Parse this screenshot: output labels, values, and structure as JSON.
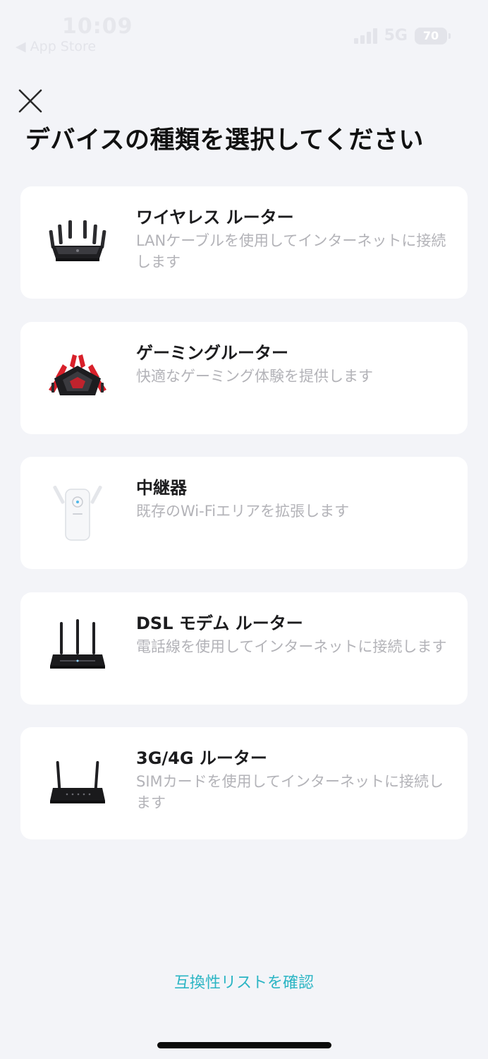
{
  "status_bar": {
    "time": "10:09",
    "back_label": "◀ App Store",
    "network": "5G",
    "battery": "70"
  },
  "header": {
    "close_icon": "close-icon",
    "title": "デバイスの種類を選択してください"
  },
  "devices": [
    {
      "title": "ワイヤレス ルーター",
      "description": "LANケーブルを使用してインターネットに接続します",
      "icon": "wireless-router-icon"
    },
    {
      "title": "ゲーミングルーター",
      "description": "快適なゲーミング体験を提供します",
      "icon": "gaming-router-icon"
    },
    {
      "title": "中継器",
      "description": "既存のWi-Fiエリアを拡張します",
      "icon": "range-extender-icon"
    },
    {
      "title": "DSL モデム ルーター",
      "description": "電話線を使用してインターネットに接続します",
      "icon": "dsl-modem-router-icon"
    },
    {
      "title": "3G/4G ルーター",
      "description": "SIMカードを使用してインターネットに接続します",
      "icon": "lte-router-icon"
    }
  ],
  "footer": {
    "compat_link": "互換性リストを確認"
  },
  "colors": {
    "background": "#f3f4f8",
    "card": "#ffffff",
    "accent": "#2bb5c4",
    "gaming_red": "#d8202a"
  }
}
